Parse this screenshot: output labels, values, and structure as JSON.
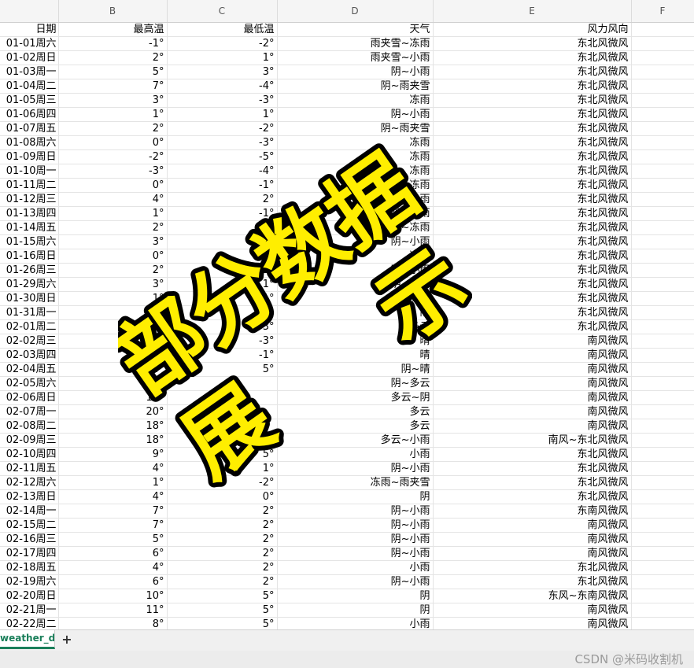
{
  "columns": [
    "",
    "B",
    "C",
    "D",
    "E",
    "F"
  ],
  "header_row": [
    "日期",
    "最高温",
    "最低温",
    "天气",
    "风力风向",
    ""
  ],
  "rows": [
    [
      "01-01周六",
      "-1°",
      "-2°",
      "雨夹雪~冻雨",
      "东北风微风"
    ],
    [
      "01-02周日",
      "2°",
      "1°",
      "雨夹雪~小雨",
      "东北风微风"
    ],
    [
      "01-03周一",
      "5°",
      "3°",
      "阴~小雨",
      "东北风微风"
    ],
    [
      "01-04周二",
      "7°",
      "-4°",
      "阴~雨夹雪",
      "东北风微风"
    ],
    [
      "01-05周三",
      "3°",
      "-3°",
      "冻雨",
      "东北风微风"
    ],
    [
      "01-06周四",
      "1°",
      "1°",
      "阴~小雨",
      "东北风微风"
    ],
    [
      "01-07周五",
      "2°",
      "-2°",
      "阴~雨夹雪",
      "东北风微风"
    ],
    [
      "01-08周六",
      "0°",
      "-3°",
      "冻雨",
      "东北风微风"
    ],
    [
      "01-09周日",
      "-2°",
      "-5°",
      "冻雨",
      "东北风微风"
    ],
    [
      "01-10周一",
      "-3°",
      "-4°",
      "冻雨",
      "东北风微风"
    ],
    [
      "01-11周二",
      "0°",
      "-1°",
      "冻雨",
      "东北风微风"
    ],
    [
      "01-12周三",
      "4°",
      "2°",
      "阴~小雨",
      "东北风微风"
    ],
    [
      "01-13周四",
      "1°",
      "-1°",
      "阴~冻雨",
      "东北风微风"
    ],
    [
      "01-14周五",
      "2°",
      "-1°",
      "阴~冻雨",
      "东北风微风"
    ],
    [
      "01-15周六",
      "3°",
      "1°",
      "阴~小雨",
      "东北风微风"
    ],
    [
      "01-16周日",
      "0°",
      "-2°",
      "冻雨",
      "东北风微风"
    ],
    [
      "01-26周三",
      "2°",
      "1°",
      "阴~小雨",
      "东北风微风"
    ],
    [
      "01-29周六",
      "3°",
      "1°",
      "阴~小雨",
      "东北风微风"
    ],
    [
      "01-30周日",
      "1°",
      "-1°",
      "冻雨",
      "东北风微风"
    ],
    [
      "01-31周一",
      "",
      "",
      "阴",
      "东北风微风"
    ],
    [
      "02-01周二",
      "",
      "-3°",
      "多云",
      "东北风微风"
    ],
    [
      "02-02周三",
      "",
      "-3°",
      "晴",
      "南风微风"
    ],
    [
      "02-03周四",
      "",
      "-1°",
      "晴",
      "南风微风"
    ],
    [
      "02-04周五",
      "14°",
      "5°",
      "阴~晴",
      "南风微风"
    ],
    [
      "02-05周六",
      "14°",
      "",
      "阴~多云",
      "南风微风"
    ],
    [
      "02-06周日",
      "18°",
      "",
      "多云~阴",
      "南风微风"
    ],
    [
      "02-07周一",
      "20°",
      "",
      "多云",
      "南风微风"
    ],
    [
      "02-08周二",
      "18°",
      "",
      "多云",
      "南风微风"
    ],
    [
      "02-09周三",
      "18°",
      "",
      "多云~小雨",
      "南风~东北风微风"
    ],
    [
      "02-10周四",
      "9°",
      "5°",
      "小雨",
      "东北风微风"
    ],
    [
      "02-11周五",
      "4°",
      "1°",
      "阴~小雨",
      "东北风微风"
    ],
    [
      "02-12周六",
      "1°",
      "-2°",
      "冻雨~雨夹雪",
      "东北风微风"
    ],
    [
      "02-13周日",
      "4°",
      "0°",
      "阴",
      "东北风微风"
    ],
    [
      "02-14周一",
      "7°",
      "2°",
      "阴~小雨",
      "东南风微风"
    ],
    [
      "02-15周二",
      "7°",
      "2°",
      "阴~小雨",
      "南风微风"
    ],
    [
      "02-16周三",
      "5°",
      "2°",
      "阴~小雨",
      "南风微风"
    ],
    [
      "02-17周四",
      "6°",
      "2°",
      "阴~小雨",
      "南风微风"
    ],
    [
      "02-18周五",
      "4°",
      "2°",
      "小雨",
      "东北风微风"
    ],
    [
      "02-19周六",
      "6°",
      "2°",
      "阴~小雨",
      "东北风微风"
    ],
    [
      "02-20周日",
      "10°",
      "5°",
      "阴",
      "东风~东南风微风"
    ],
    [
      "02-21周一",
      "11°",
      "5°",
      "阴",
      "南风微风"
    ],
    [
      "02-22周二",
      "8°",
      "5°",
      "小雨",
      "南风微风"
    ]
  ],
  "watermark": {
    "line1": "部分数据",
    "line2a": "展",
    "line2b": "示",
    "fill": "#ffee00",
    "stroke": "#000000"
  },
  "sheet_tab": "weather_data",
  "add_sheet_label": "+",
  "credit": "CSDN @米码收割机",
  "colors": {
    "tab_active": "#1a7f5a",
    "header_bg": "#f5f5f5",
    "grid_line": "#e4e4e4"
  }
}
